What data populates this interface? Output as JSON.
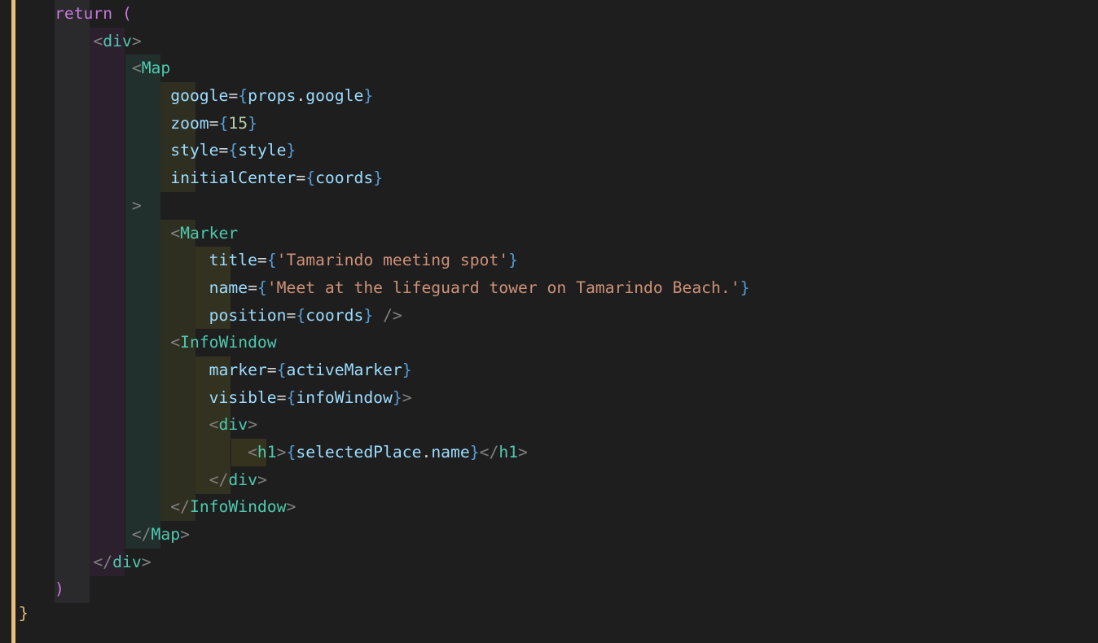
{
  "colors": {
    "background": "#1e1e1e",
    "keywordReturn": "#c678dd",
    "parenYellow": "#e5c07b",
    "parenPink": "#c678dd",
    "angleBracket": "#808080",
    "componentTag": "#4ec9b0",
    "attribute": "#9cdcfe",
    "braceProp": "#569cd6",
    "number": "#b5cea8",
    "string": "#ce9178",
    "defaultText": "#d4d4d4",
    "closeBraceYellow": "#e5c07b",
    "guide": "#404040",
    "gutterMark": "#e5c07b"
  },
  "code": {
    "line0": {
      "kw": "return",
      "open": "("
    },
    "line1": {
      "open": "<",
      "tag": "div",
      "close": ">"
    },
    "line2": {
      "open": "<",
      "tag": "Map"
    },
    "line3": {
      "attr": "google",
      "eq": "=",
      "ob": "{",
      "obj1": "props",
      "dot": ".",
      "obj2": "google",
      "cb": "}"
    },
    "line4": {
      "attr": "zoom",
      "eq": "=",
      "ob": "{",
      "num": "15",
      "cb": "}"
    },
    "line5": {
      "attr": "style",
      "eq": "=",
      "ob": "{",
      "var": "style",
      "cb": "}"
    },
    "line6": {
      "attr": "initialCenter",
      "eq": "=",
      "ob": "{",
      "var": "coords",
      "cb": "}"
    },
    "line7": {
      "close": ">"
    },
    "line8": {
      "open": "<",
      "tag": "Marker"
    },
    "line9": {
      "attr": "title",
      "eq": "=",
      "ob": "{",
      "str": "'Tamarindo meeting spot'",
      "cb": "}"
    },
    "line10": {
      "attr": "name",
      "eq": "=",
      "ob": "{",
      "str": "'Meet at the lifeguard tower on Tamarindo Beach.'",
      "cb": "}"
    },
    "line11": {
      "attr": "position",
      "eq": "=",
      "ob": "{",
      "var": "coords",
      "cb": "}",
      "selfclose": " />"
    },
    "line12": {
      "open": "<",
      "tag": "InfoWindow"
    },
    "line13": {
      "attr": "marker",
      "eq": "=",
      "ob": "{",
      "var": "activeMarker",
      "cb": "}"
    },
    "line14": {
      "attr": "visible",
      "eq": "=",
      "ob": "{",
      "var": "infoWindow",
      "cb": "}",
      "close": ">"
    },
    "line15": {
      "open": "<",
      "tag": "div",
      "close": ">"
    },
    "line16": {
      "open": "<",
      "tag": "h1",
      "close1": ">",
      "ob": "{",
      "obj1": "selectedPlace",
      "dot": ".",
      "obj2": "name",
      "cb": "}",
      "open2": "</",
      "tag2": "h1",
      "close2": ">"
    },
    "line17": {
      "open": "</",
      "tag": "div",
      "close": ">"
    },
    "line18": {
      "open": "</",
      "tag": "InfoWindow",
      "close": ">"
    },
    "line19": {
      "open": "</",
      "tag": "Map",
      "close": ">"
    },
    "line20": {
      "open": "</",
      "tag": "div",
      "close": ">"
    },
    "line21": {
      "close": ")"
    },
    "line22": {
      "brace": "}"
    }
  },
  "metrics": {
    "lineHeight": 33.7,
    "charWidth": 10.84,
    "leftPadding": 48
  },
  "indentBlocks": [
    {
      "col": 0,
      "startLine": 0,
      "endLine": 21,
      "color": "#2a292b",
      "width": 43
    },
    {
      "col": 4,
      "startLine": 1,
      "endLine": 20,
      "color": "#2c1f2e",
      "width": 43
    },
    {
      "col": 8,
      "startLine": 2,
      "endLine": 19,
      "color": "#21302d",
      "width": 43
    },
    {
      "col": 12,
      "startLine": 3,
      "endLine": 6,
      "color": "#2f2f21",
      "width": 43
    },
    {
      "col": 12,
      "startLine": 8,
      "endLine": 18,
      "color": "#2f2f21",
      "width": 43
    },
    {
      "col": 16,
      "startLine": 9,
      "endLine": 11,
      "color": "#33311f",
      "width": 43
    },
    {
      "col": 16,
      "startLine": 13,
      "endLine": 17,
      "color": "#33311f",
      "width": 43
    },
    {
      "col": 20,
      "startLine": 16,
      "endLine": 16,
      "color": "#35331e",
      "width": 43
    }
  ]
}
